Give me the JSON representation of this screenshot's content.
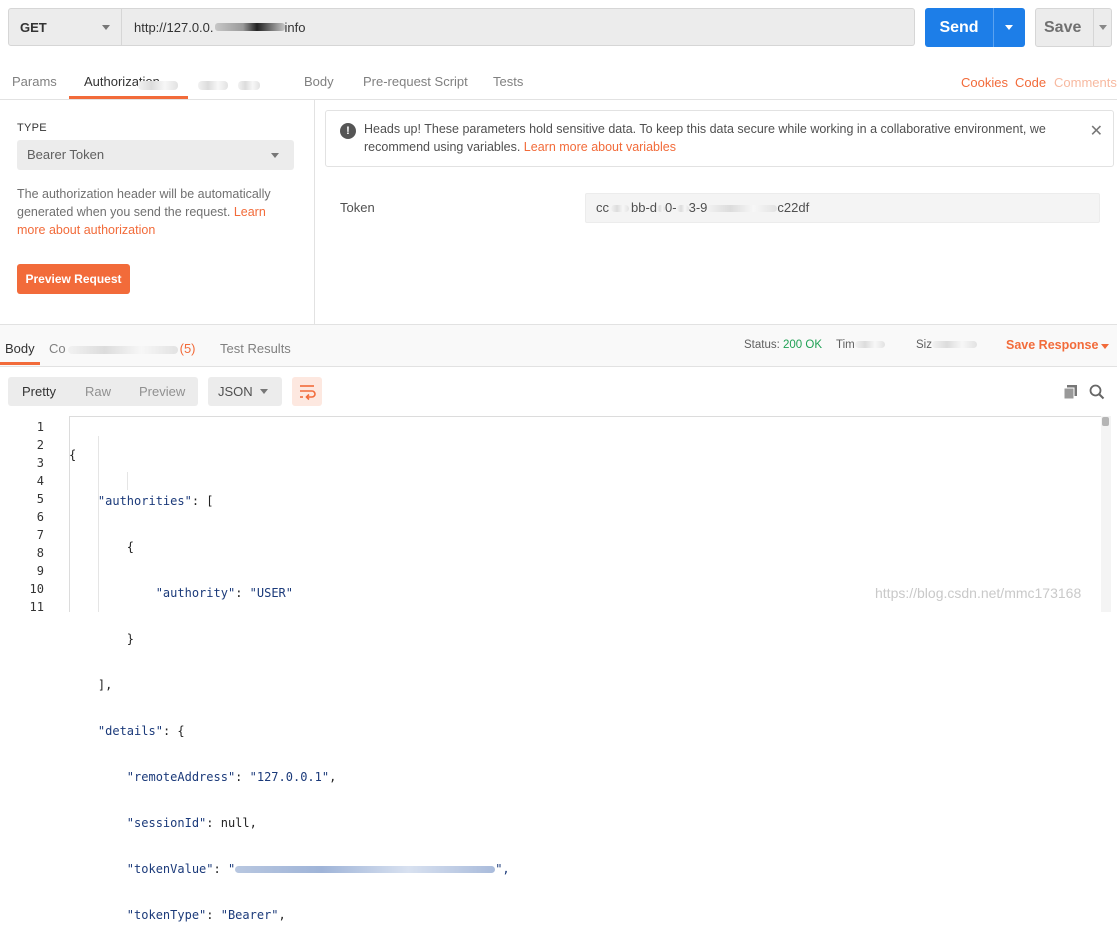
{
  "request": {
    "method": "GET",
    "url_prefix": "http://127.0.0.",
    "url_suffix": "info",
    "send_label": "Send",
    "save_label": "Save"
  },
  "request_tabs": [
    {
      "label": "Params"
    },
    {
      "label": "Authorization",
      "active": true
    },
    {
      "label": "Body"
    },
    {
      "label": "Pre-request Script"
    },
    {
      "label": "Tests"
    }
  ],
  "request_links": {
    "cookies": "Cookies",
    "code": "Code",
    "comments": "Comments"
  },
  "auth": {
    "type_label": "TYPE",
    "type_value": "Bearer Token",
    "description": "The authorization header will be automatically generated when you send the request. ",
    "learn_link": "Learn more about authorization",
    "preview_button": "Preview Request",
    "notice_text": "Heads up! These parameters hold sensitive data. To keep this data secure while working in a collaborative environment, we recommend using variables. ",
    "notice_link": "Learn more about variables",
    "token_label": "Token",
    "token_value_start": "cc",
    "token_value_mid": "bb-d",
    "token_value_mid2": "0-",
    "token_value_mid3": "3-9",
    "token_value_end": "c22df"
  },
  "response": {
    "tabs": [
      {
        "label": "Body",
        "active": true
      },
      {
        "label": "Co",
        "count": "(5)"
      },
      {
        "label": "Test Results"
      }
    ],
    "status_label": "Status:",
    "status_value": "200 OK",
    "time_label": "Tim",
    "size_label": "Siz",
    "save_response": "Save Response",
    "view_modes": [
      "Pretty",
      "Raw",
      "Preview"
    ],
    "format": "JSON"
  },
  "code": {
    "line_numbers": [
      "1",
      "2",
      "3",
      "4",
      "5",
      "6",
      "7",
      "8",
      "9",
      "10",
      "11"
    ]
  },
  "watermark": "https://blog.csdn.net/mmc173168",
  "colors": {
    "accent": "#f26b3a",
    "send_blue": "#1d7ee8",
    "status_green": "#20a155"
  }
}
